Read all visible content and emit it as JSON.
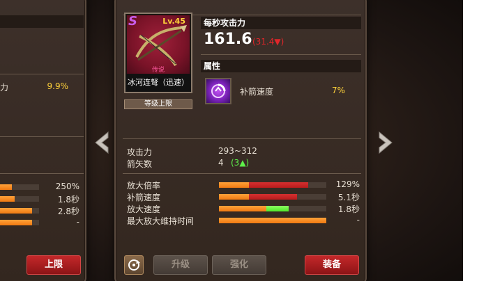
{
  "left_panel": {
    "stat_label_partial": "力",
    "stat_value": "9.9%",
    "rows": [
      {
        "value": "250%",
        "fill": 0.3
      },
      {
        "value": "1.8秒",
        "fill": 0.38
      },
      {
        "value": "2.8秒",
        "fill": 0.82
      },
      {
        "value": "-",
        "fill": 0.82
      }
    ],
    "button_label": "上限"
  },
  "item": {
    "rank": "S",
    "level": "Lv.45",
    "grade": "传说",
    "name": "冰河连弩（迅速）",
    "limit_tag": "等级上限"
  },
  "dps": {
    "heading": "每秒攻击力",
    "value": "161.6",
    "diff": "(31.4▼)"
  },
  "attribute": {
    "heading": "属性",
    "name": "补箭速度",
    "value": "7%"
  },
  "base_stats": [
    {
      "label": "攻击力",
      "value": "293~312"
    },
    {
      "label": "箭矢数",
      "value": "4",
      "bonus": "(3▲)"
    }
  ],
  "compare_stats": [
    {
      "label": "放大倍率",
      "value": "129%",
      "orange": 0.28,
      "red": 0.83,
      "green": 0
    },
    {
      "label": "补箭速度",
      "value": "5.1秒",
      "orange": 0.28,
      "red": 0.73,
      "green": 0
    },
    {
      "label": "放大速度",
      "value": "1.8秒",
      "orange": 0.44,
      "red": 0,
      "green": 0.65
    },
    {
      "label": "最大放大维持时间",
      "value": "-",
      "orange": 1.0,
      "red": 0,
      "green": 0
    }
  ],
  "buttons": {
    "upgrade": "升级",
    "enhance": "强化",
    "equip": "装备"
  },
  "colors": {
    "orange": "#f07a12",
    "red": "#b81c1c",
    "green": "#4ee82a",
    "gold": "#ffd23a"
  }
}
